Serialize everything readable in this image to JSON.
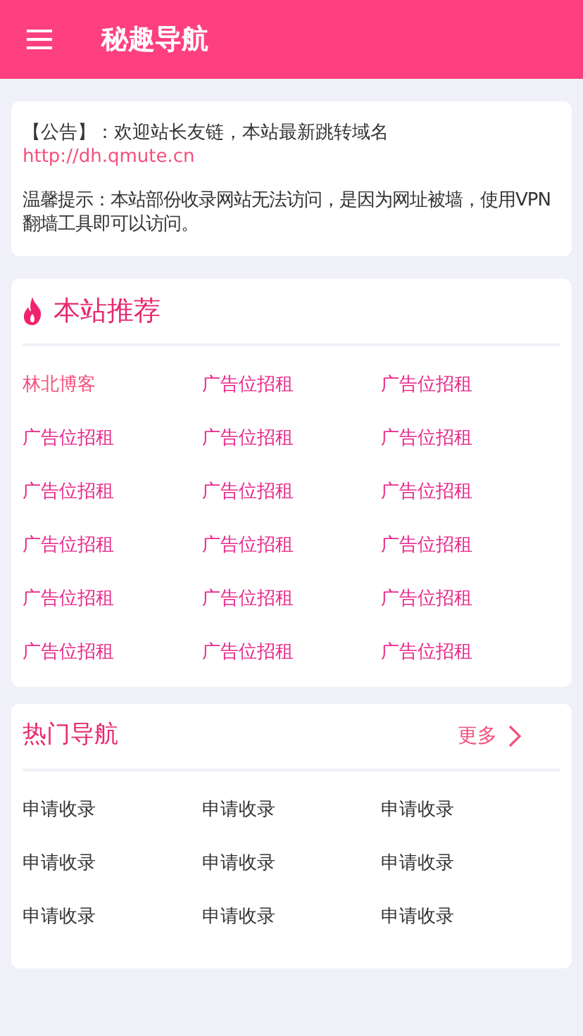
{
  "header": {
    "title": "秘趣导航"
  },
  "notice": {
    "announcement": "【公告】：欢迎站长友链，本站最新跳转域名",
    "link": "http://dh.qmute.cn",
    "tip": "温馨提示：本站部份收录网站无法访问，是因为网址被墙，使用VPN翻墙工具即可以访问。"
  },
  "recommended": {
    "title": "本站推荐",
    "items": [
      {
        "label": "林北博客",
        "color": "#f4507e"
      },
      {
        "label": "广告位招租",
        "color": "#e8288a"
      },
      {
        "label": "广告位招租",
        "color": "#e8288a"
      },
      {
        "label": "广告位招租",
        "color": "#e8288a"
      },
      {
        "label": "广告位招租",
        "color": "#e8288a"
      },
      {
        "label": "广告位招租",
        "color": "#e8288a"
      },
      {
        "label": "广告位招租",
        "color": "#e8288a"
      },
      {
        "label": "广告位招租",
        "color": "#e8288a"
      },
      {
        "label": "广告位招租",
        "color": "#e8288a"
      },
      {
        "label": "广告位招租",
        "color": "#e8288a"
      },
      {
        "label": "广告位招租",
        "color": "#e8288a"
      },
      {
        "label": "广告位招租",
        "color": "#e8288a"
      },
      {
        "label": "广告位招租",
        "color": "#e8288a"
      },
      {
        "label": "广告位招租",
        "color": "#e8288a"
      },
      {
        "label": "广告位招租",
        "color": "#e8288a"
      },
      {
        "label": "广告位招租",
        "color": "#e8288a"
      },
      {
        "label": "广告位招租",
        "color": "#e8288a"
      },
      {
        "label": "广告位招租",
        "color": "#e8288a"
      }
    ]
  },
  "hot": {
    "title": "热门导航",
    "more": "更多",
    "items": [
      "申请收录",
      "申请收录",
      "申请收录",
      "申请收录",
      "申请收录",
      "申请收录",
      "申请收录",
      "申请收录",
      "申请收录"
    ]
  }
}
